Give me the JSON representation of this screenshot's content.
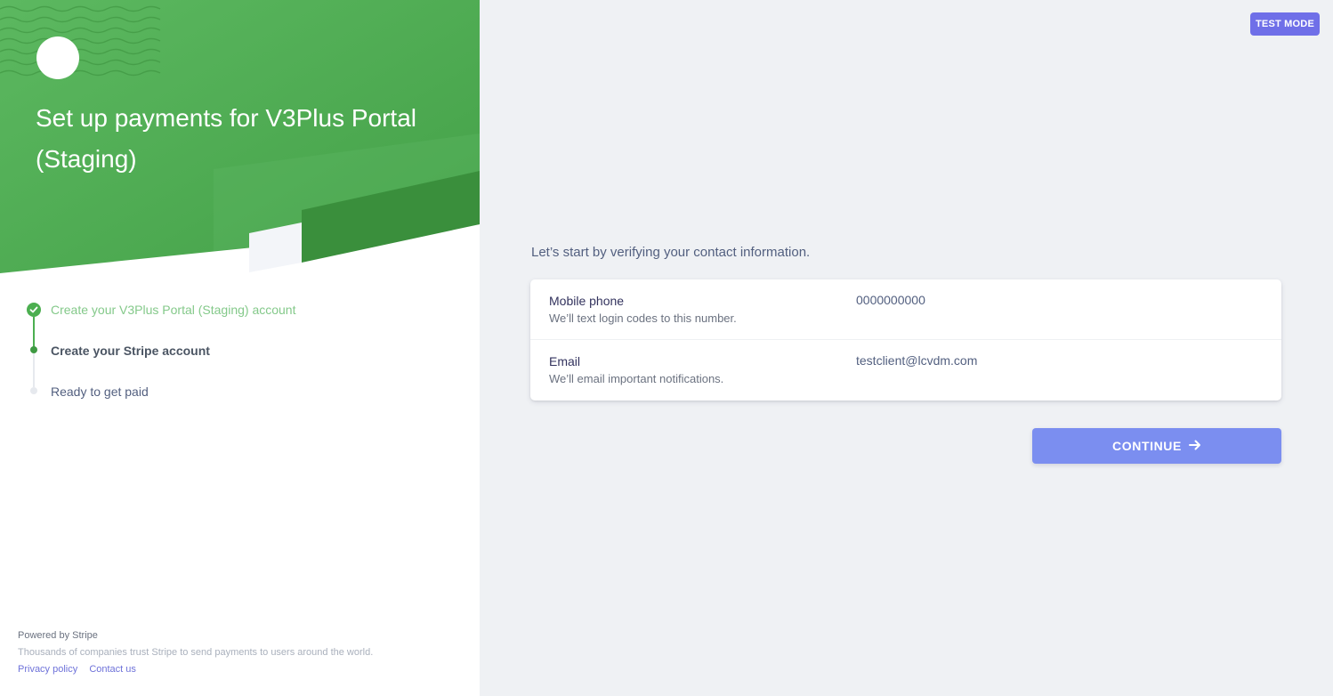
{
  "hero": {
    "title": "Set up payments for V3Plus Portal (Staging)"
  },
  "steps": [
    {
      "label": "Create your V3Plus Portal (Staging) account",
      "state": "complete"
    },
    {
      "label": "Create your Stripe account",
      "state": "current"
    },
    {
      "label": "Ready to get paid",
      "state": "upcoming"
    }
  ],
  "footer": {
    "powered": "Powered by Stripe",
    "trust": "Thousands of companies trust Stripe to send payments to users around the world.",
    "privacy": "Privacy policy",
    "contact": "Contact us"
  },
  "badge": {
    "test_mode": "TEST MODE"
  },
  "main": {
    "intro": "Let’s start by verifying your contact information.",
    "fields": [
      {
        "label": "Mobile phone",
        "description": "We’ll text login codes to this number.",
        "value": "0000000000"
      },
      {
        "label": "Email",
        "description": "We’ll email important notifications.",
        "value": "testclient@lcvdm.com"
      }
    ],
    "continue_label": "CONTINUE"
  },
  "colors": {
    "brand_green": "#4caf50",
    "accent_blue": "#7b8ef0",
    "test_mode": "#6f6fe8"
  },
  "icons": {
    "step_complete": "check-icon",
    "continue": "arrow-right-icon"
  }
}
